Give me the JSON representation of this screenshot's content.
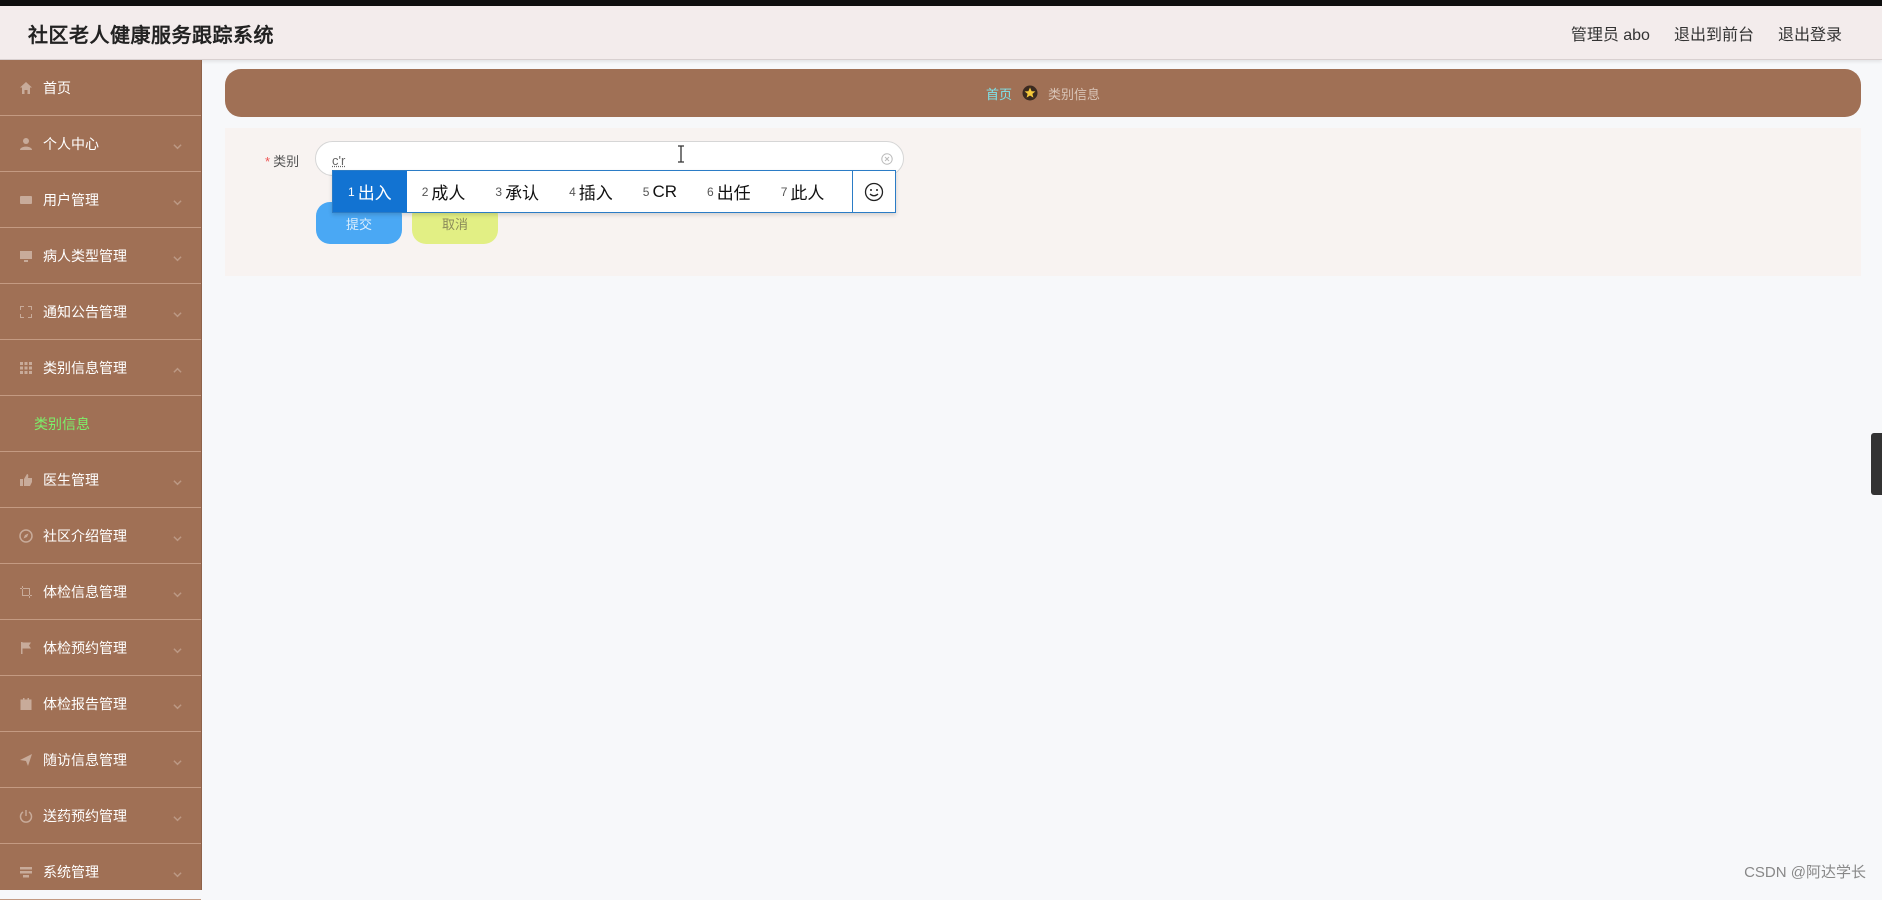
{
  "app": {
    "title": "社区老人健康服务跟踪系统"
  },
  "header": {
    "admin": "管理员 abo",
    "exit_front": "退出到前台",
    "logout": "退出登录"
  },
  "sidebar": {
    "items": [
      {
        "label": "首页",
        "icon": "home-icon"
      },
      {
        "label": "个人中心",
        "icon": "user-icon"
      },
      {
        "label": "用户管理",
        "icon": "card-icon"
      },
      {
        "label": "病人类型管理",
        "icon": "monitor-icon"
      },
      {
        "label": "通知公告管理",
        "icon": "frame-icon"
      },
      {
        "label": "类别信息管理",
        "icon": "grid-icon",
        "sub": "类别信息"
      },
      {
        "label": "医生管理",
        "icon": "thumb-icon"
      },
      {
        "label": "社区介绍管理",
        "icon": "compass-icon"
      },
      {
        "label": "体检信息管理",
        "icon": "crop-icon"
      },
      {
        "label": "体检预约管理",
        "icon": "flag-icon"
      },
      {
        "label": "体检报告管理",
        "icon": "calendar-icon"
      },
      {
        "label": "随访信息管理",
        "icon": "send-icon"
      },
      {
        "label": "送药预约管理",
        "icon": "power-icon"
      },
      {
        "label": "系统管理",
        "icon": "list-icon"
      }
    ]
  },
  "breadcrumb": {
    "home": "首页",
    "current": "类别信息"
  },
  "form": {
    "label": "类别",
    "value": "c'r",
    "submit": "提交",
    "cancel": "取消"
  },
  "ime": {
    "candidates": [
      {
        "n": "1",
        "text": "出入"
      },
      {
        "n": "2",
        "text": "成人"
      },
      {
        "n": "3",
        "text": "承认"
      },
      {
        "n": "4",
        "text": "插入"
      },
      {
        "n": "5",
        "text": "CR"
      },
      {
        "n": "6",
        "text": "出任"
      },
      {
        "n": "7",
        "text": "此人"
      }
    ]
  },
  "watermark": "CSDN @阿达学长",
  "colors": {
    "sidebar": "#a07055",
    "submit": "#4aa8f4",
    "cancel": "#e2ef84",
    "ime_selected": "#1273d2"
  }
}
